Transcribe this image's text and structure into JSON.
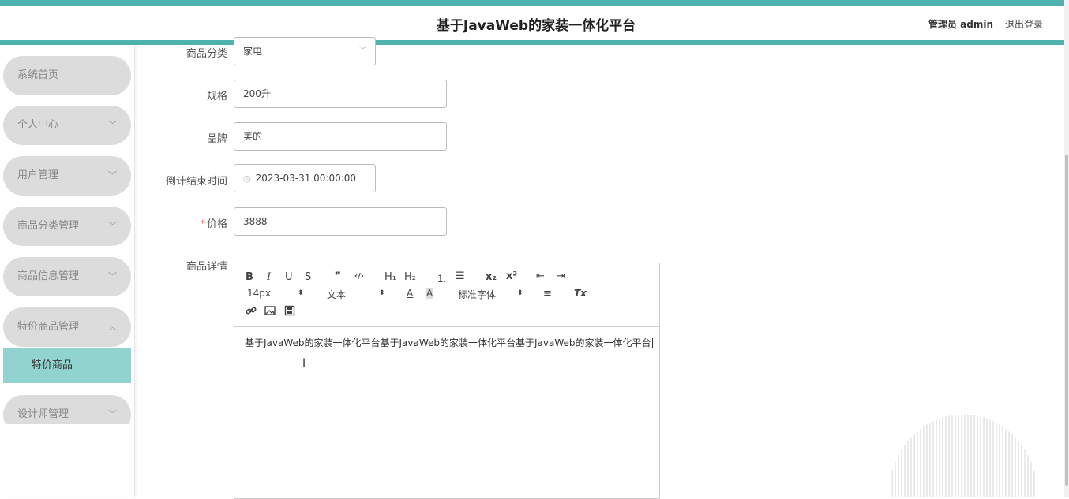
{
  "header": {
    "title": "基于JavaWeb的家装一体化平台",
    "admin": "管理员 admin",
    "logout": "退出登录"
  },
  "sidebar": {
    "items": [
      {
        "label": "系统首页",
        "chevron": ""
      },
      {
        "label": "个人中心",
        "chevron": "﹀"
      },
      {
        "label": "用户管理",
        "chevron": "﹀"
      },
      {
        "label": "商品分类管理",
        "chevron": "﹀"
      },
      {
        "label": "商品信息管理",
        "chevron": "﹀"
      },
      {
        "label": "特价商品管理",
        "chevron": "︿"
      },
      {
        "label": "设计师管理",
        "chevron": "﹀"
      }
    ],
    "active_sub": "特价商品"
  },
  "form": {
    "category": {
      "label": "商品分类",
      "value": "家电"
    },
    "spec": {
      "label": "规格",
      "value": "200升"
    },
    "brand": {
      "label": "品牌",
      "value": "美的"
    },
    "countdown": {
      "label": "倒计结束时间",
      "value": "2023-03-31 00:00:00"
    },
    "price": {
      "label": "价格",
      "required_mark": "*",
      "value": "3888"
    },
    "detail": {
      "label": "商品详情"
    }
  },
  "editor": {
    "toolbar": {
      "bold": "B",
      "italic": "I",
      "underline": "U",
      "strike": "S",
      "quote": "❞",
      "code": "‹/›",
      "h1": "H₁",
      "h2": "H₂",
      "ordered": "⒈",
      "bullet": "☰",
      "sub": "x₂",
      "sup": "x²",
      "outdent": "⇤",
      "indent": "⇥",
      "size": "14px",
      "color_mode": "文本",
      "font": "标准字体",
      "align": "≡",
      "clear": "Tx",
      "link": "🔗",
      "image": "▨",
      "video": "▦"
    },
    "content": "基于JavaWeb的家装一体化平台基于JavaWeb的家装一体化平台基于JavaWeb的家装一体化平台"
  },
  "colors": {
    "accent": "#4db3ac",
    "submenu_active": "#91d3cf",
    "menu_bg": "#dcdcdc"
  }
}
